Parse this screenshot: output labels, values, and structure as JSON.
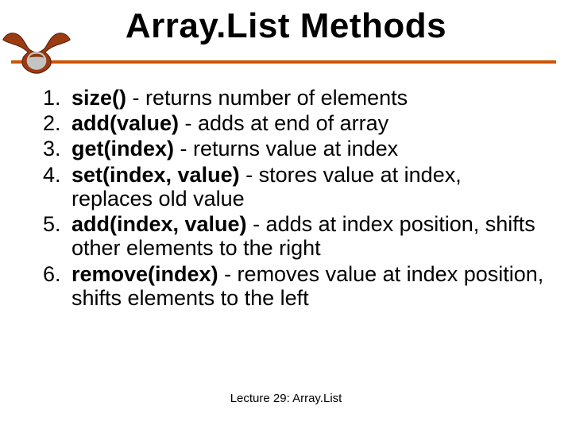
{
  "title": "Array.List Methods",
  "logo_name": "longhorn-logo",
  "accent_color": "#cc5500",
  "methods": [
    {
      "sig": "size()",
      "desc": " - returns number of elements"
    },
    {
      "sig": "add(value)",
      "desc": " - adds at end of array"
    },
    {
      "sig": "get(index)",
      "desc": " - returns value at index"
    },
    {
      "sig": "set(index, value)",
      "desc": " - stores value at index, replaces old value"
    },
    {
      "sig": "add(index, value)",
      "desc": " - adds at index position, shifts other elements to the right"
    },
    {
      "sig": "remove(index)",
      "desc": " - removes value at index position, shifts elements to the left"
    }
  ],
  "footer": "Lecture 29: Array.List"
}
